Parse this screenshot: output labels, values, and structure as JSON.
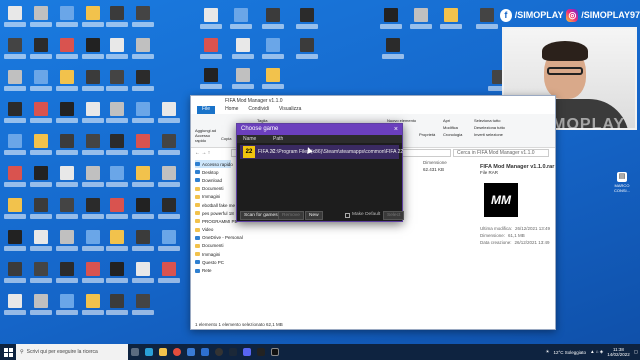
{
  "banner": {
    "facebook_handle": "/SIMOPLAY",
    "instagram_handle": "/SIMOPLAY97"
  },
  "watermark": "SIMOPLAY",
  "explorer": {
    "title": "FIFA Mod Manager v1.1.0",
    "tabs": [
      "File",
      "Home",
      "Condividi",
      "Visualizza"
    ],
    "ribbon": {
      "pin_label": "Aggiungi ad Accesso rapido",
      "copy_label": "Copia",
      "cut_label": "Taglia",
      "new_item_label": "Nuovo elemento",
      "properties_label": "Proprietà",
      "open_label": "Apri",
      "modify_label": "Modifica",
      "history_label": "Cronologia",
      "select_all_label": "Seleziona tutto",
      "select_none_label": "Deseleziona tutto",
      "invert_label": "Inverti selezione"
    },
    "search_placeholder": "Cerca in FIFA Mod Manager v1.1.0",
    "nav": [
      "Accesso rapido",
      "Desktop",
      "Download",
      "Documenti",
      "Immagini",
      "ebotball fake me",
      "pes powerful 18",
      "PROGRAMMI PE",
      "Video",
      "OneDrive - Personal",
      "Documenti",
      "Immagini",
      "Questo PC",
      "Rete"
    ],
    "columns": {
      "dimension": "Dimensione"
    },
    "file_size": "62.431 KB",
    "detail": {
      "file_name": "FIFA Mod Manager v1.1.0.rar",
      "file_type": "File RAR",
      "modified_label": "Ultima modifica:",
      "modified_value": "26/12/2021 13:49",
      "size_label": "Dimensione:",
      "size_value": "61,1 MB",
      "created_label": "Data creazione:",
      "created_value": "26/12/2021 13:49",
      "logo_text": "MM"
    },
    "status": "1 elemento    1 elemento selezionato 62,1 MB"
  },
  "dialog": {
    "title": "Choose game",
    "close": "×",
    "col_name": "Name",
    "col_path": "Path",
    "game_icon": "22",
    "game_name": "FIFA 22",
    "game_path": "C:\\Program Files (x86)\\Steam\\steamapps\\common\\FIFA 22",
    "scan_button": "Scan for games",
    "remove_button": "Remove",
    "new_button": "New",
    "make_default": "Make Default",
    "select_button": "Select"
  },
  "side_icon": {
    "label": "MARCO CONSI..."
  },
  "taskbar": {
    "search_placeholder": "Scrivi qui per eseguire la ricerca",
    "weather": "12°C Soleggiato",
    "time": "11:38",
    "date": "14/02/2022"
  }
}
